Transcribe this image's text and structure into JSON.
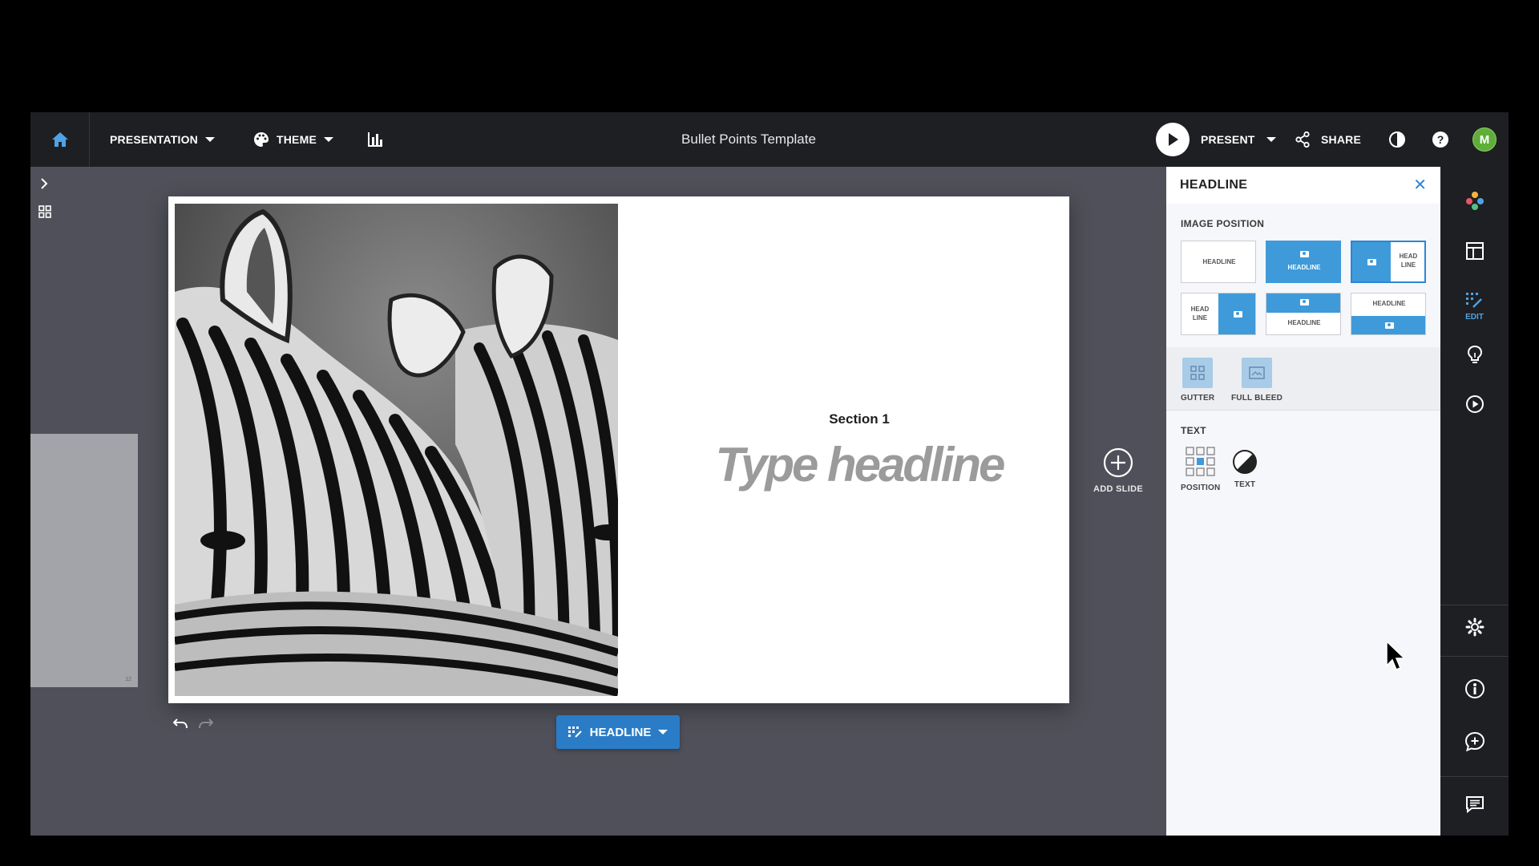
{
  "topbar": {
    "presentation_label": "PRESENTATION",
    "theme_label": "THEME",
    "doc_title": "Bullet Points Template",
    "present_label": "PRESENT",
    "share_label": "SHARE",
    "avatar_initial": "M"
  },
  "slide": {
    "section_label": "Section 1",
    "headline_placeholder": "Type headline",
    "thumbnail_number": "12"
  },
  "add_slide_label": "ADD SLIDE",
  "layout_button_label": "HEADLINE",
  "panel": {
    "title": "HEADLINE",
    "image_position_label": "IMAGE POSITION",
    "options": {
      "text_only": "HEADLINE",
      "image_top_text": "HEADLINE",
      "text_right_line1": "HEAD",
      "text_right_line2": "LINE",
      "text_left_line1": "HEAD",
      "text_left_line2": "LINE",
      "image_top_split": "HEADLINE",
      "text_top_image_bottom": "HEADLINE"
    },
    "gutter_label": "GUTTER",
    "full_bleed_label": "FULL BLEED",
    "text_section_label": "TEXT",
    "position_label": "POSITION",
    "text_label": "TEXT"
  },
  "rail": {
    "edit_label": "EDIT"
  },
  "colors": {
    "accent": "#2a7cc7",
    "selected_blue": "#3f9ad9",
    "topbar_bg": "#1e1f22",
    "canvas_bg": "#4f5059"
  }
}
